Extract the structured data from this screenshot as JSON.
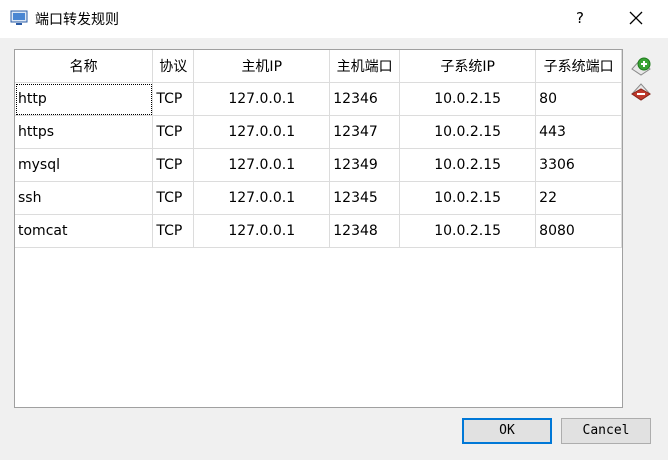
{
  "window": {
    "title": "端口转发规则",
    "help_label": "?",
    "app_icon": "network-window-icon",
    "close_icon": "close-icon"
  },
  "table": {
    "headers": [
      "名称",
      "协议",
      "主机IP",
      "主机端口",
      "子系统IP",
      "子系统端口"
    ],
    "rows": [
      [
        "http",
        "TCP",
        "127.0.0.1",
        "12346",
        "10.0.2.15",
        "80"
      ],
      [
        "https",
        "TCP",
        "127.0.0.1",
        "12347",
        "10.0.2.15",
        "443"
      ],
      [
        "mysql",
        "TCP",
        "127.0.0.1",
        "12349",
        "10.0.2.15",
        "3306"
      ],
      [
        "ssh",
        "TCP",
        "127.0.0.1",
        "12345",
        "10.0.2.15",
        "22"
      ],
      [
        "tomcat",
        "TCP",
        "127.0.0.1",
        "12348",
        "10.0.2.15",
        "8080"
      ]
    ]
  },
  "side_actions": {
    "add_icon": "add-rule-icon",
    "remove_icon": "remove-rule-icon",
    "colors": {
      "add": "#3aa335",
      "remove": "#c0392b"
    }
  },
  "buttons": {
    "ok": "OK",
    "cancel": "Cancel"
  },
  "colors": {
    "accent": "#0078d7",
    "grid": "#dcdcdc"
  }
}
